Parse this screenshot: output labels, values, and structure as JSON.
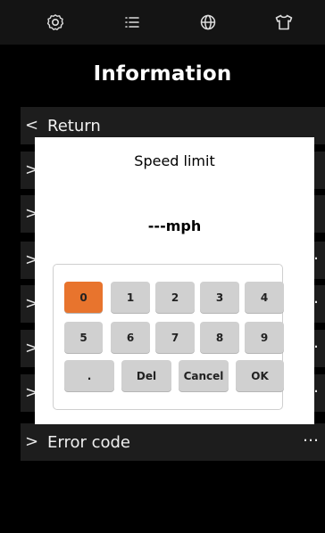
{
  "topbar": {
    "tabs": [
      {
        "icon": "settings-icon"
      },
      {
        "icon": "list-icon"
      },
      {
        "icon": "globe-icon"
      },
      {
        "icon": "shirt-icon"
      }
    ]
  },
  "header": {
    "title": "Information"
  },
  "list": {
    "items": [
      {
        "label": "Return",
        "more": ""
      },
      {
        "label": "",
        "more": ""
      },
      {
        "label": "",
        "more": ""
      },
      {
        "label": "",
        "more": "…"
      },
      {
        "label": "",
        "more": "…"
      },
      {
        "label": "",
        "more": "…"
      },
      {
        "label": "",
        "more": "…"
      },
      {
        "label": "Error code",
        "more": "…"
      }
    ]
  },
  "dialog": {
    "title": "Speed limit",
    "value": "---mph",
    "keys": [
      [
        "0",
        "1",
        "2",
        "3",
        "4"
      ],
      [
        "5",
        "6",
        "7",
        "8",
        "9"
      ],
      [
        ".",
        "Del",
        "Cancel",
        "OK"
      ]
    ],
    "active_key": "0"
  },
  "colors": {
    "accent": "#e8742d",
    "background": "#000000",
    "row_bg": "#1d1d1d",
    "key_bg": "#d0d0d0"
  }
}
